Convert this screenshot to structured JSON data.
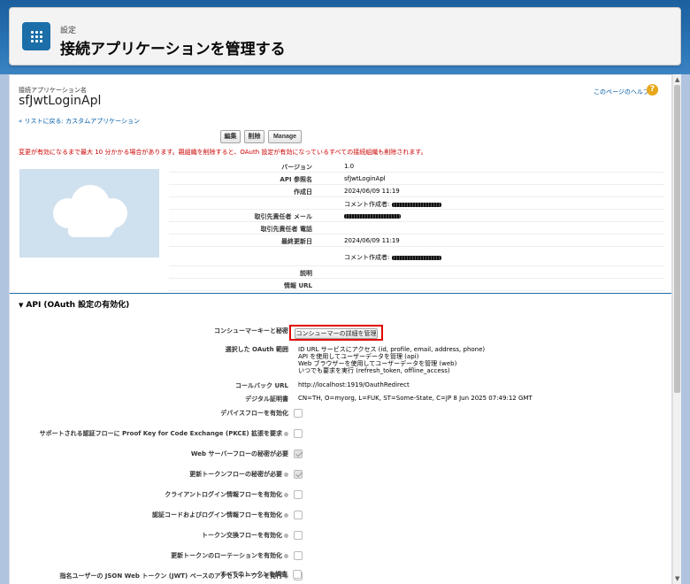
{
  "header": {
    "eyebrow": "設定",
    "title": "接続アプリケーションを管理する"
  },
  "app": {
    "name_label": "接続アプリケーション名",
    "name": "sfJwtLoginApl",
    "help_link": "このページのヘルプ",
    "back_link": "« リストに戻る: カスタムアプリケーション"
  },
  "buttons": {
    "edit": "編集",
    "delete": "削除",
    "manage": "Manage"
  },
  "warning": "変更が有効になるまで最大 10 分かかる場合があります。親組織を削除すると、OAuth 設定が有効になっているすべての接続組織も削除されます。",
  "details": {
    "version_label": "バージョン",
    "version": "1.0",
    "api_name_label": "API 参照名",
    "api_name": "sfJwtLoginApl",
    "created_label": "作成日",
    "created": "2024/06/09 11:19",
    "created_by_prefix": "コメント作成者:",
    "contact_email_label": "取引先責任者 メール",
    "contact_phone_label": "取引先責任者 電話",
    "modified_label": "最終更新日",
    "modified": "2024/06/09 11:19",
    "modified_by_prefix": "コメント作成者:",
    "description_label": "説明",
    "info_url_label": "情報 URL"
  },
  "oauth": {
    "section_title": "API (OAuth 設定の有効化)",
    "consumer_label": "コンシューマーキーと秘密",
    "consumer_button": "コンシューマーの詳細を管理",
    "scopes_label": "選択した OAuth 範囲",
    "scopes": [
      "ID URL サービスにアクセス (id, profile, email, address, phone)",
      "API を使用してユーザーデータを管理 (api)",
      "Web ブラウザーを使用してユーザーデータを管理 (web)",
      "いつでも要求を実行 (refresh_token, offline_access)"
    ],
    "callback_label": "コールバック URL",
    "callback": "http://localhost:1919/OauthRedirect",
    "cert_label": "デジタル証明書",
    "cert": "CN=TH, O=myorg, L=FUK, ST=Some-State, C=JP 8 Jun 2025 07:49:12 GMT",
    "flags": [
      {
        "label": "デバイスフローを有効化",
        "info": false,
        "checked": false
      },
      {
        "label": "サポートされる認証フローに Proof Key for Code Exchange (PKCE) 拡張を要求",
        "info": true,
        "checked": false
      },
      {
        "label": "Web サーバーフローの秘密が必要",
        "info": false,
        "checked": true
      },
      {
        "label": "更新トークンフローの秘密が必要",
        "info": true,
        "checked": true
      },
      {
        "label": "クライアントログイン情報フローを有効化",
        "info": true,
        "checked": false
      },
      {
        "label": "認証コードおよびログイン情報フローを有効化",
        "info": true,
        "checked": false
      },
      {
        "label": "トークン交換フローを有効化",
        "info": true,
        "checked": false
      },
      {
        "label": "更新トークンのローテーションを有効化",
        "info": true,
        "checked": false
      },
      {
        "label": "指名ユーザーの JSON Web トークン (JWT) ベースのアクセストークンを発行",
        "info": true,
        "checked": false
      },
      {
        "label": "すべてのトークンを調査",
        "info": false,
        "checked": false
      }
    ]
  },
  "colors": {
    "brand": "#1b6ea8",
    "warning": "#cc0000",
    "highlight": "#e00000",
    "link": "#015ba7"
  }
}
